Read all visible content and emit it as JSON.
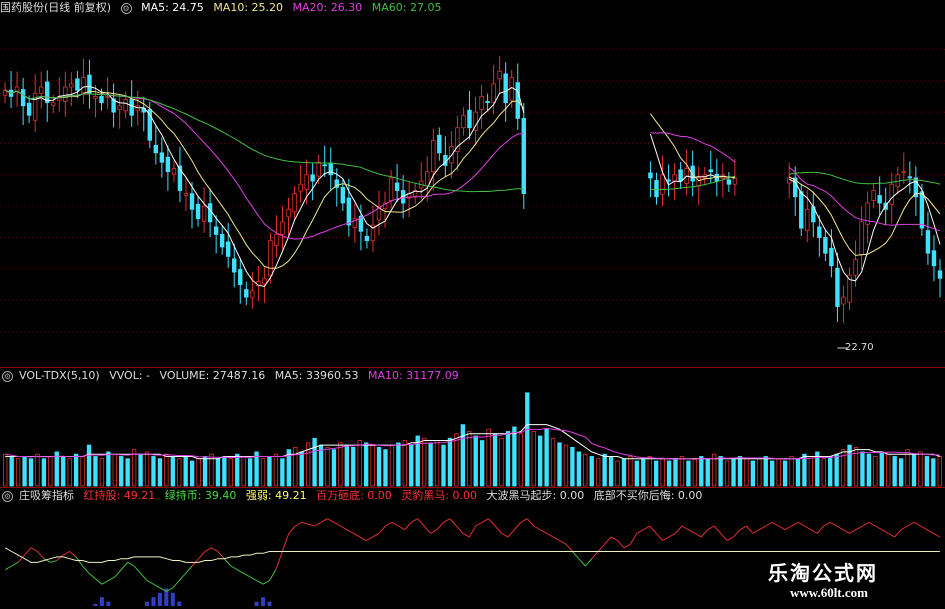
{
  "price_header": {
    "title": "国药股份",
    "mode": "(日线 前复权)",
    "ma5": "MA5: 24.75",
    "ma10": "MA10: 25.20",
    "ma20": "MA20: 26.30",
    "ma60": "MA60: 27.05"
  },
  "vol_header": {
    "name": "VOL-TDX(5,10)",
    "vvol": "VVOL: -",
    "volume": "VOLUME: 27487.16",
    "ma5": "MA5: 33960.53",
    "ma10": "MA10: 31177.09"
  },
  "ind_header": {
    "name": "庄吸筹指标",
    "red": "红持股: 49.21",
    "green": "绿持币: 39.40",
    "strength": "强弱: 49.21",
    "million": "百万砸底: 0.00",
    "horse": "灵豹黑马: 0.00",
    "wave": "大波黑马起步: 0.00",
    "bottom": "底部不买你后悔: 0.00"
  },
  "price_low_label": "22.70",
  "watermark": {
    "title": "乐淘公式网",
    "url": "www.60lt.com"
  },
  "colors": {
    "up": "#e03030",
    "down": "#40e0ff",
    "ma5": "#ffffff",
    "ma10": "#f0e68c",
    "ma20": "#e040e0",
    "ma60": "#40c040",
    "grid": "#6a0000"
  },
  "chart_data": [
    {
      "type": "candlestick",
      "title": "国药股份 (日线 前复权)",
      "ylim": [
        21.5,
        32.5
      ],
      "close": [
        30.2,
        30.0,
        30.3,
        29.7,
        29.4,
        30.1,
        30.3,
        29.8,
        29.8,
        30.0,
        30.3,
        30.4,
        30.2,
        30.6,
        30.1,
        30.0,
        29.8,
        30.0,
        29.5,
        29.7,
        29.9,
        29.4,
        29.7,
        29.5,
        28.6,
        28.2,
        27.9,
        27.6,
        27.7,
        27.0,
        26.9,
        26.4,
        26.1,
        26.5,
        26.0,
        25.6,
        25.2,
        24.9,
        24.4,
        24.0,
        23.6,
        23.8,
        24.1,
        24.2,
        25.4,
        25.6,
        26.0,
        26.4,
        26.9,
        27.2,
        27.5,
        27.3,
        27.9,
        27.8,
        27.5,
        27.1,
        26.6,
        25.9,
        26.1,
        25.7,
        25.4,
        25.9,
        26.5,
        26.6,
        27.4,
        27.0,
        26.6,
        26.9,
        27.0,
        27.3,
        27.6,
        28.6,
        28.2,
        27.8,
        28.4,
        29.0,
        29.4,
        29.0,
        29.5,
        30.0,
        29.8,
        30.4,
        30.8,
        29.8,
        30.6,
        29.3,
        26.9,
        null,
        null,
        null,
        null,
        null,
        null,
        null,
        null,
        null,
        null,
        null,
        null,
        null,
        null,
        null,
        null,
        null,
        null,
        null,
        null,
        27.4,
        26.8,
        27.5,
        27.3,
        27.5,
        27.3,
        27.7,
        27.3,
        27.4,
        27.5,
        27.6,
        27.3,
        27.5,
        27.2,
        27.4,
        null,
        null,
        null,
        null,
        null,
        null,
        null,
        null,
        27.4,
        26.8,
        25.8,
        26.4,
        26.0,
        25.5,
        25.0,
        24.6,
        23.3,
        23.6,
        24.3,
        24.8,
        26.0,
        26.6,
        27.0,
        26.6,
        26.4,
        27.2,
        27.5,
        27.6,
        27.4,
        26.8,
        25.8,
        25.0,
        24.6,
        24.2
      ]
    },
    {
      "type": "bar",
      "title": "VOL-TDX(5,10)",
      "series": [
        {
          "name": "VOLUME",
          "values": [
            14,
            13,
            12,
            13,
            12,
            14,
            12,
            13,
            15,
            13,
            12,
            14,
            13,
            18,
            13,
            12,
            15,
            14,
            13,
            12,
            16,
            14,
            15,
            13,
            12,
            14,
            13,
            12,
            13,
            11,
            12,
            13,
            14,
            12,
            13,
            12,
            14,
            13,
            12,
            15,
            12,
            13,
            14,
            12,
            16,
            17,
            15,
            19,
            21,
            18,
            17,
            16,
            19,
            18,
            17,
            20,
            19,
            18,
            17,
            16,
            18,
            19,
            20,
            18,
            22,
            21,
            19,
            20,
            18,
            21,
            23,
            27,
            24,
            22,
            20,
            25,
            23,
            21,
            24,
            26,
            23,
            41,
            24,
            22,
            25,
            21,
            19,
            18,
            17,
            15,
            14,
            13,
            12,
            14,
            13,
            11,
            12,
            13,
            11,
            12,
            13,
            11,
            12,
            11,
            12,
            13,
            11,
            12,
            13,
            12,
            14,
            13,
            11,
            12,
            13,
            12,
            11,
            12,
            13,
            11,
            12,
            11,
            13,
            12,
            14,
            13,
            15,
            12,
            13,
            14,
            16,
            18,
            17,
            15,
            14,
            13,
            15,
            14,
            13,
            12,
            16,
            14,
            15,
            13,
            12,
            13
          ]
        },
        {
          "name": "MA5",
          "values": [
            13,
            13,
            13,
            13,
            13,
            13,
            13,
            13,
            13,
            13,
            13,
            13,
            13,
            14,
            14,
            14,
            14,
            14,
            14,
            14,
            14,
            14,
            14,
            14,
            14,
            13,
            13,
            13,
            13,
            13,
            12,
            12,
            12,
            12,
            13,
            13,
            13,
            13,
            13,
            13,
            13,
            13,
            13,
            13,
            14,
            14,
            15,
            16,
            17,
            18,
            18,
            18,
            18,
            18,
            18,
            18,
            18,
            18,
            18,
            18,
            18,
            18,
            18,
            19,
            19,
            20,
            20,
            20,
            20,
            20,
            21,
            22,
            23,
            23,
            23,
            23,
            23,
            23,
            23,
            23,
            24,
            27,
            27,
            27,
            27,
            26,
            25,
            23,
            21,
            19,
            17,
            15,
            14,
            13,
            13,
            13,
            12,
            12,
            12,
            12,
            12,
            12,
            12,
            12,
            12,
            12,
            12,
            12,
            12,
            12,
            12,
            12,
            12,
            12,
            12,
            12,
            12,
            12,
            12,
            12,
            12,
            12,
            12,
            12,
            13,
            13,
            13,
            13,
            13,
            14,
            15,
            15,
            16,
            16,
            16,
            15,
            15,
            14,
            14,
            14,
            14,
            14,
            14,
            14,
            14,
            13
          ]
        }
      ]
    },
    {
      "type": "line",
      "title": "庄吸筹指标",
      "series": [
        {
          "name": "红持股",
          "values": [
            20,
            22,
            24,
            28,
            32,
            30,
            26,
            24,
            25,
            28,
            30,
            27,
            22,
            18,
            15,
            12,
            14,
            16,
            20,
            24,
            22,
            18,
            14,
            12,
            10,
            8,
            10,
            14,
            18,
            22,
            26,
            30,
            32,
            30,
            26,
            22,
            20,
            18,
            16,
            14,
            12,
            14,
            20,
            30,
            40,
            44,
            46,
            45,
            44,
            46,
            48,
            46,
            44,
            42,
            40,
            38,
            36,
            38,
            40,
            44,
            46,
            44,
            42,
            46,
            48,
            44,
            40,
            42,
            46,
            48,
            44,
            40,
            38,
            44,
            46,
            48,
            44,
            40,
            38,
            42,
            46,
            48,
            44,
            42,
            40,
            38,
            36,
            34,
            30,
            26,
            22,
            26,
            30,
            34,
            38,
            36,
            32,
            34,
            40,
            42,
            44,
            40,
            36,
            38,
            40,
            44,
            42,
            40,
            38,
            42,
            44,
            40,
            36,
            38,
            42,
            44,
            40,
            42,
            44,
            46,
            44,
            42,
            44,
            46,
            44,
            42,
            40,
            44,
            46,
            44,
            42,
            40,
            42,
            44,
            46,
            44,
            42,
            40,
            38,
            42,
            44,
            46,
            44,
            42,
            40,
            38
          ]
        },
        {
          "name": "绿持币",
          "values": [
            32,
            30,
            28,
            26,
            24,
            24,
            25,
            26,
            27,
            27,
            26,
            25,
            25,
            24,
            24,
            24,
            25,
            25,
            26,
            26,
            27,
            27,
            27,
            27,
            27,
            26,
            25,
            25,
            24,
            24,
            24,
            25,
            25,
            26,
            26,
            27,
            27,
            28,
            28,
            29,
            29,
            30,
            30,
            30,
            30,
            30,
            30,
            30,
            30,
            30,
            30,
            30,
            30,
            30,
            30,
            30,
            30,
            30,
            30,
            30,
            30,
            30,
            30,
            30,
            30,
            30,
            30,
            30,
            30,
            30,
            30,
            30,
            30,
            30,
            30,
            30,
            30,
            30,
            30,
            30,
            30,
            30,
            30,
            30,
            30,
            30,
            30,
            30,
            30,
            30,
            30,
            30,
            30,
            30,
            30,
            30,
            30,
            30,
            30,
            30,
            30,
            30,
            30,
            30,
            30,
            30,
            30,
            30,
            30,
            30,
            30,
            30,
            30,
            30,
            30,
            30,
            30,
            30,
            30,
            30,
            30,
            30,
            30,
            30,
            30,
            30,
            30,
            30,
            30,
            30,
            30,
            30,
            30,
            30,
            30,
            30,
            30,
            30,
            30,
            30,
            30,
            30,
            30,
            30,
            30,
            30
          ]
        }
      ]
    }
  ]
}
